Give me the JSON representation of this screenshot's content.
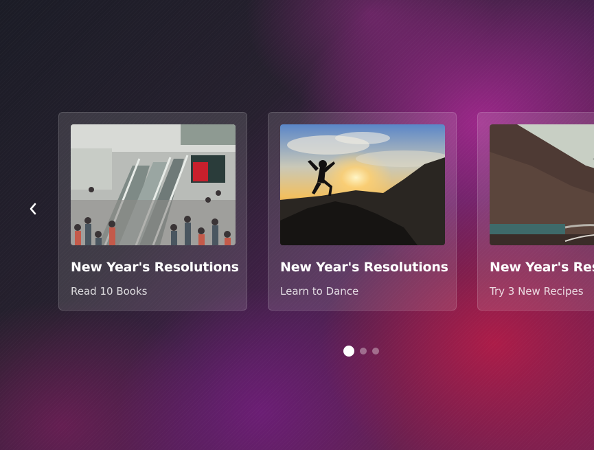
{
  "carousel": {
    "prev_icon": "chevron-left-icon",
    "cards": [
      {
        "title": "New Year's Resolutions",
        "subtitle": "Read 10 Books",
        "image": "crowded-escalator-photo"
      },
      {
        "title": "New Year's Resolutions",
        "subtitle": "Learn to Dance",
        "image": "jumping-silhouette-sunset-photo"
      },
      {
        "title": "New Year's Resolutions",
        "subtitle": "Try 3 New Recipes",
        "image": "mountain-lake-road-photo"
      }
    ],
    "pagination": {
      "count": 3,
      "active_index": 0
    }
  },
  "colors": {
    "text_primary": "#ffffff",
    "card_bg": "rgba(255,255,255,0.12)",
    "accent_magenta": "#a0288c",
    "accent_crimson": "#b01c48"
  }
}
